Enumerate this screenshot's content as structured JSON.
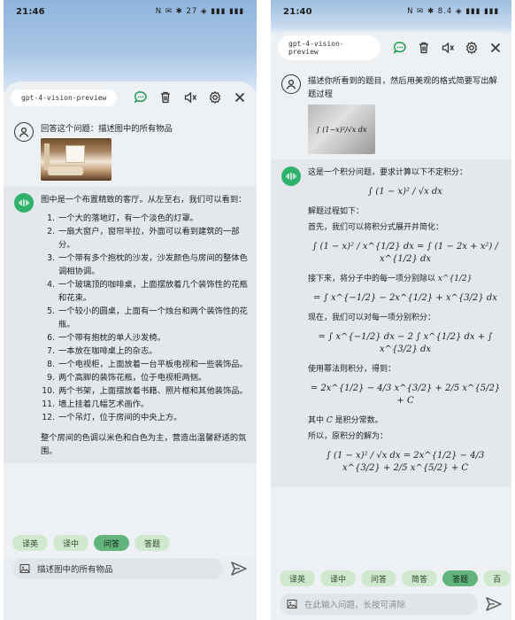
{
  "left": {
    "status": {
      "time": "21:46",
      "icons": "N ✉ ✱ 27 ◈ ▮▮▮ ▮▮▮"
    },
    "header": {
      "model": "gpt-4-vision-preview"
    },
    "user_message": "回答这个问题：描述图中的所有物品",
    "bot_message": {
      "intro": "图中是一个布置精致的客厅。从左至右，我们可以看到：",
      "items": [
        {
          "num": "1.",
          "text": "一个大的落地灯，有一个淡色的灯罩。"
        },
        {
          "num": "2.",
          "text": "一扇大窗户，窗帘半拉，外面可以看到建筑的一部分。"
        },
        {
          "num": "3.",
          "text": "一个带有多个抱枕的沙发，沙发颜色与房间的整体色调相协调。"
        },
        {
          "num": "4.",
          "text": "一个玻璃顶的咖啡桌，上面摆放着几个装饰性的花瓶和花束。"
        },
        {
          "num": "5.",
          "text": "一个较小的圆桌，上面有一个烛台和两个装饰性的花瓶。"
        },
        {
          "num": "6.",
          "text": "一个带有抱枕的单人沙发椅。"
        },
        {
          "num": "7.",
          "text": "一本放在咖啡桌上的杂志。"
        },
        {
          "num": "8.",
          "text": "一个电视柜，上面放着一台平板电视和一些装饰品。"
        },
        {
          "num": "9.",
          "text": "两个高脚的装饰花瓶，位于电视柜两侧。"
        },
        {
          "num": "10.",
          "text": "两个书架，上面摆放着书籍、照片框和其他装饰品。"
        },
        {
          "num": "11.",
          "text": "墙上挂着几幅艺术画作。"
        },
        {
          "num": "12.",
          "text": "一个吊灯，位于房间的中央上方。"
        }
      ],
      "outro": "整个房间的色调以米色和白色为主，营造出温馨舒适的氛围。"
    },
    "chips": [
      "译英",
      "译中",
      "问答",
      "答题"
    ],
    "active_chip": "问答",
    "input_value": "描述图中的所有物品"
  },
  "right": {
    "status": {
      "time": "21:40",
      "icons": "N ✉ ✱ 8.4 ◈ ▮▮▮ ▮▮▮"
    },
    "header": {
      "model": "gpt-4-vision-preview"
    },
    "user_message": "描述你所看到的题目，然后用美观的格式简要写出解题过程",
    "bot_message": {
      "p1": "这是一个积分问题，要求计算以下不定积分：",
      "m1": "∫ (1 − x)² / √x dx",
      "p2": "解题过程如下：",
      "p3": "首先，我们可以将积分式展开并简化：",
      "m2": "∫ (1 − x)² / x^{1/2} dx = ∫ (1 − 2x + x²) / x^{1/2} dx",
      "p4": "接下来，将分子中的每一项分别除以",
      "p4_math": "x^{1/2}",
      "m3": "= ∫ x^{−1/2} − 2x^{1/2} + x^{3/2} dx",
      "p5": "现在，我们可以对每一项分别积分：",
      "m4": "= ∫ x^{−1/2} dx − 2 ∫ x^{1/2} dx + ∫ x^{3/2} dx",
      "p6": "使用幂法则积分，得到：",
      "m5": "= 2x^{1/2} − 4/3 x^{3/2} + 2/5 x^{5/2} + C",
      "p7a": "其中",
      "p7_math": "C",
      "p7b": "是积分常数。",
      "p8": "所以，原积分的解为：",
      "m6": "∫ (1 − x)² / √x dx = 2x^{1/2} − 4/3 x^{3/2} + 2/5 x^{5/2} + C"
    },
    "chips": [
      "译英",
      "译中",
      "问答",
      "简答",
      "答题",
      "百"
    ],
    "active_chip": "答题",
    "input_placeholder": "在此输入问题，长按可清除"
  },
  "colors": {
    "accent_green": "#62b37c",
    "chip_green": "#cfe9cf",
    "bot_avatar": "#2fb36c"
  }
}
